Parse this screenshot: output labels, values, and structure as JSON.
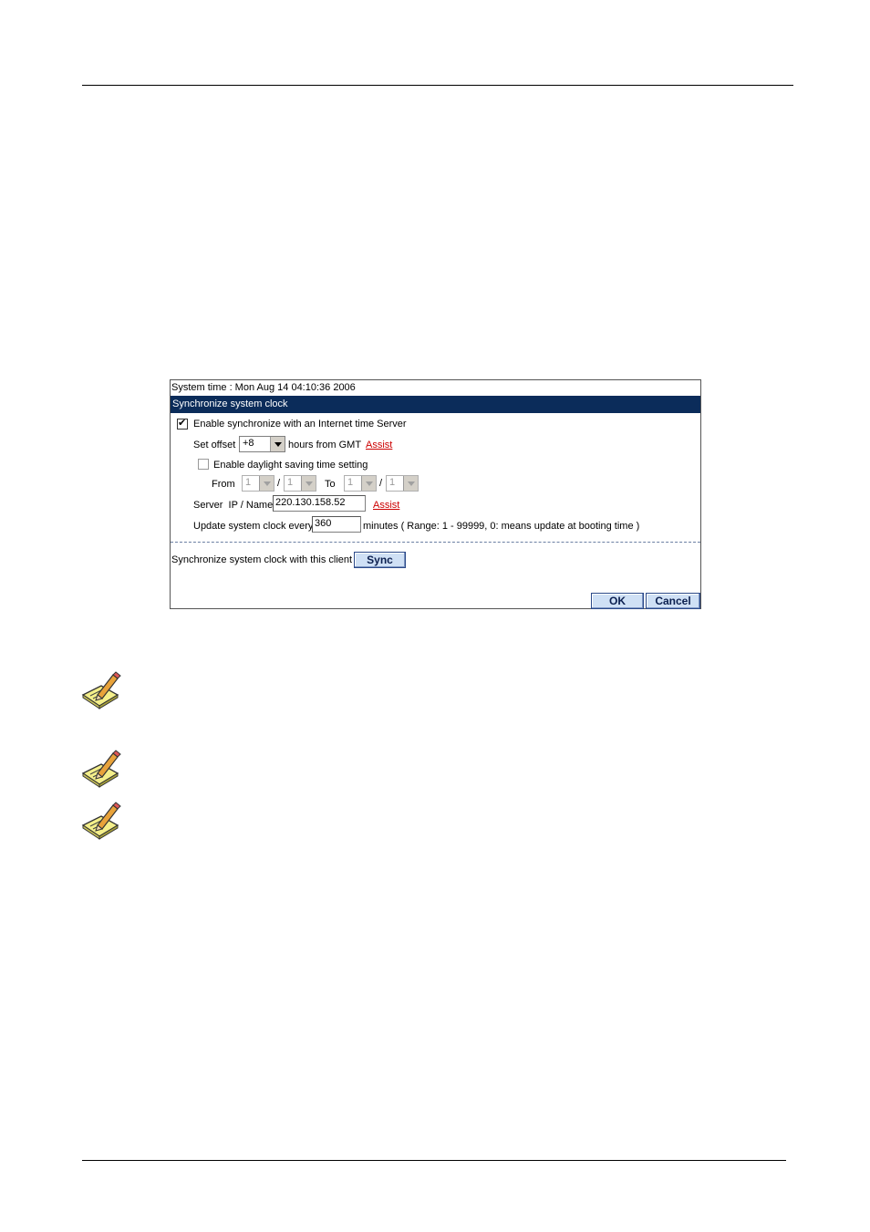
{
  "panel": {
    "system_time": "System time : Mon Aug 14 04:10:36 2006",
    "title": "Synchronize system clock",
    "enable_sync_label": "Enable synchronize with an Internet time Server",
    "enable_sync_checked": true,
    "set_offset_label": "Set offset",
    "offset_value": "+8",
    "offset_unit": "hours from GMT",
    "assist_label": "Assist",
    "daylight_label": "Enable daylight saving time setting",
    "daylight_checked": false,
    "from_label": "From",
    "to_label": "To",
    "from_month": "1",
    "from_day": "1",
    "to_month": "1",
    "to_day": "1",
    "slash": "/",
    "server_label": "Server  IP / Name",
    "server_value": "220.130.158.52",
    "update_label": "Update system clock every",
    "update_value": "360",
    "update_unit": "minutes ( Range: 1 - 99999, 0: means update at booting time )",
    "sync_client_label": "Synchronize system clock with this client",
    "sync_button": "Sync",
    "ok_button": "OK",
    "cancel_button": "Cancel"
  },
  "notes": {
    "icon": "pencil-note-icon"
  }
}
